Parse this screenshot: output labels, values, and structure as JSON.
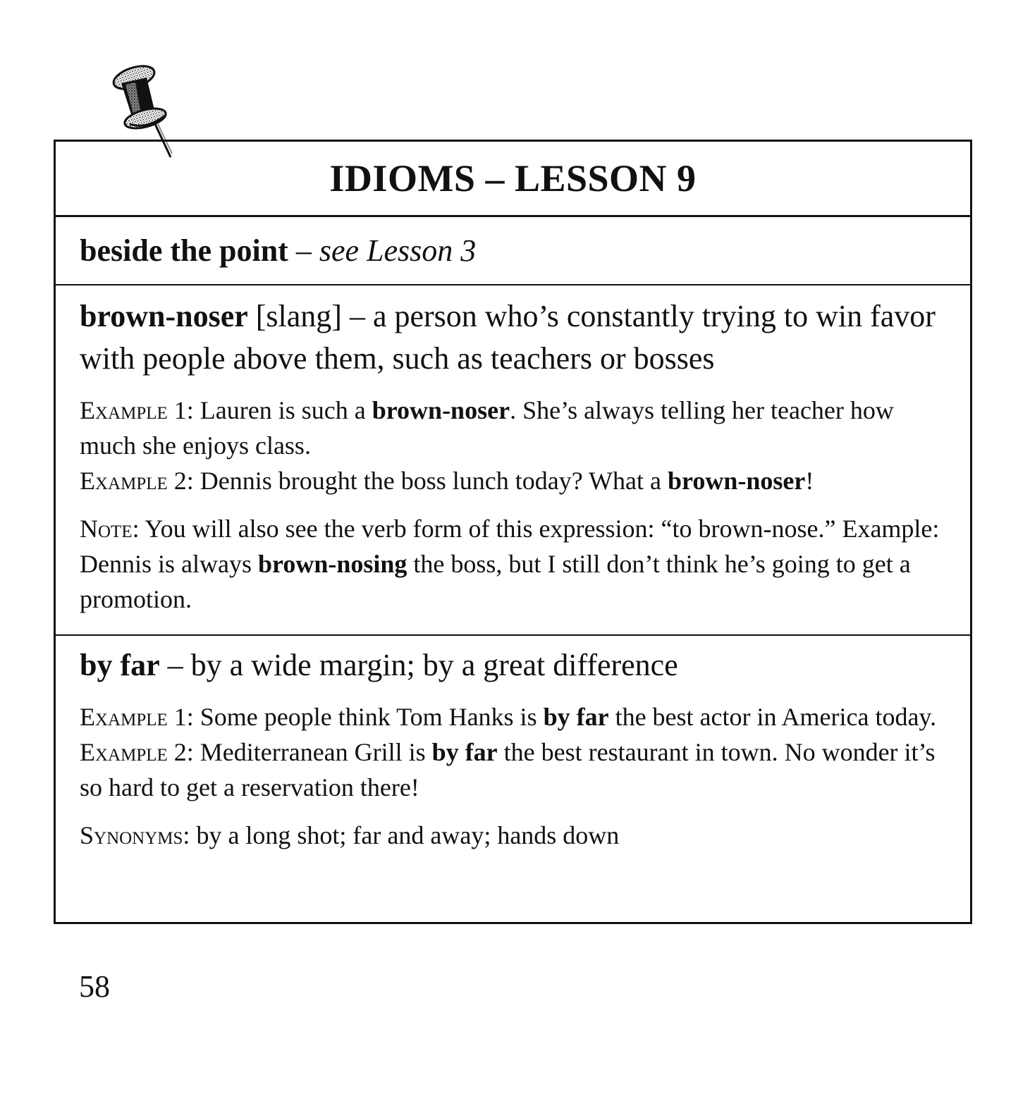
{
  "title": "IDIOMS – LESSON 9",
  "entries": [
    {
      "term": "beside the point",
      "sep": " – ",
      "see": "see Lesson 3"
    },
    {
      "term": "brown-noser",
      "definition": " [slang] – a person who’s constantly trying to win favor with people above them, such as teachers or bosses",
      "example1_label": "Example 1:",
      "example1_pre": "  Lauren is such a ",
      "example1_bold": "brown-noser",
      "example1_post": ". She’s always telling her teacher how much she enjoys class.",
      "example2_label": "Example 2:",
      "example2_pre": "  Dennis brought the boss lunch today? What a ",
      "example2_bold": "brown-noser",
      "example2_post": "!",
      "note_label": "Note:",
      "note_pre": "  You will also see the verb form of this expression: “to brown-nose.” Example: Dennis is always ",
      "note_bold": "brown-nosing",
      "note_post": " the boss, but I still don’t think he’s going to get a promotion."
    },
    {
      "term": "by far",
      "definition": " – by a wide margin; by a great difference",
      "example1_label": "Example 1:",
      "example1_pre": "  Some people think Tom Hanks is ",
      "example1_bold": "by far",
      "example1_post": " the best actor in America today.",
      "example2_label": "Example 2:",
      "example2_pre": "  Mediterranean Grill is ",
      "example2_bold": "by far",
      "example2_post": " the best restaurant in town. No wonder it’s so hard to get a reservation there!",
      "synonyms_label": "Synonyms:",
      "synonyms_text": "  by a long shot; far and away; hands down"
    }
  ],
  "page_number": "58",
  "icons": {
    "pin": "pushpin-icon"
  }
}
